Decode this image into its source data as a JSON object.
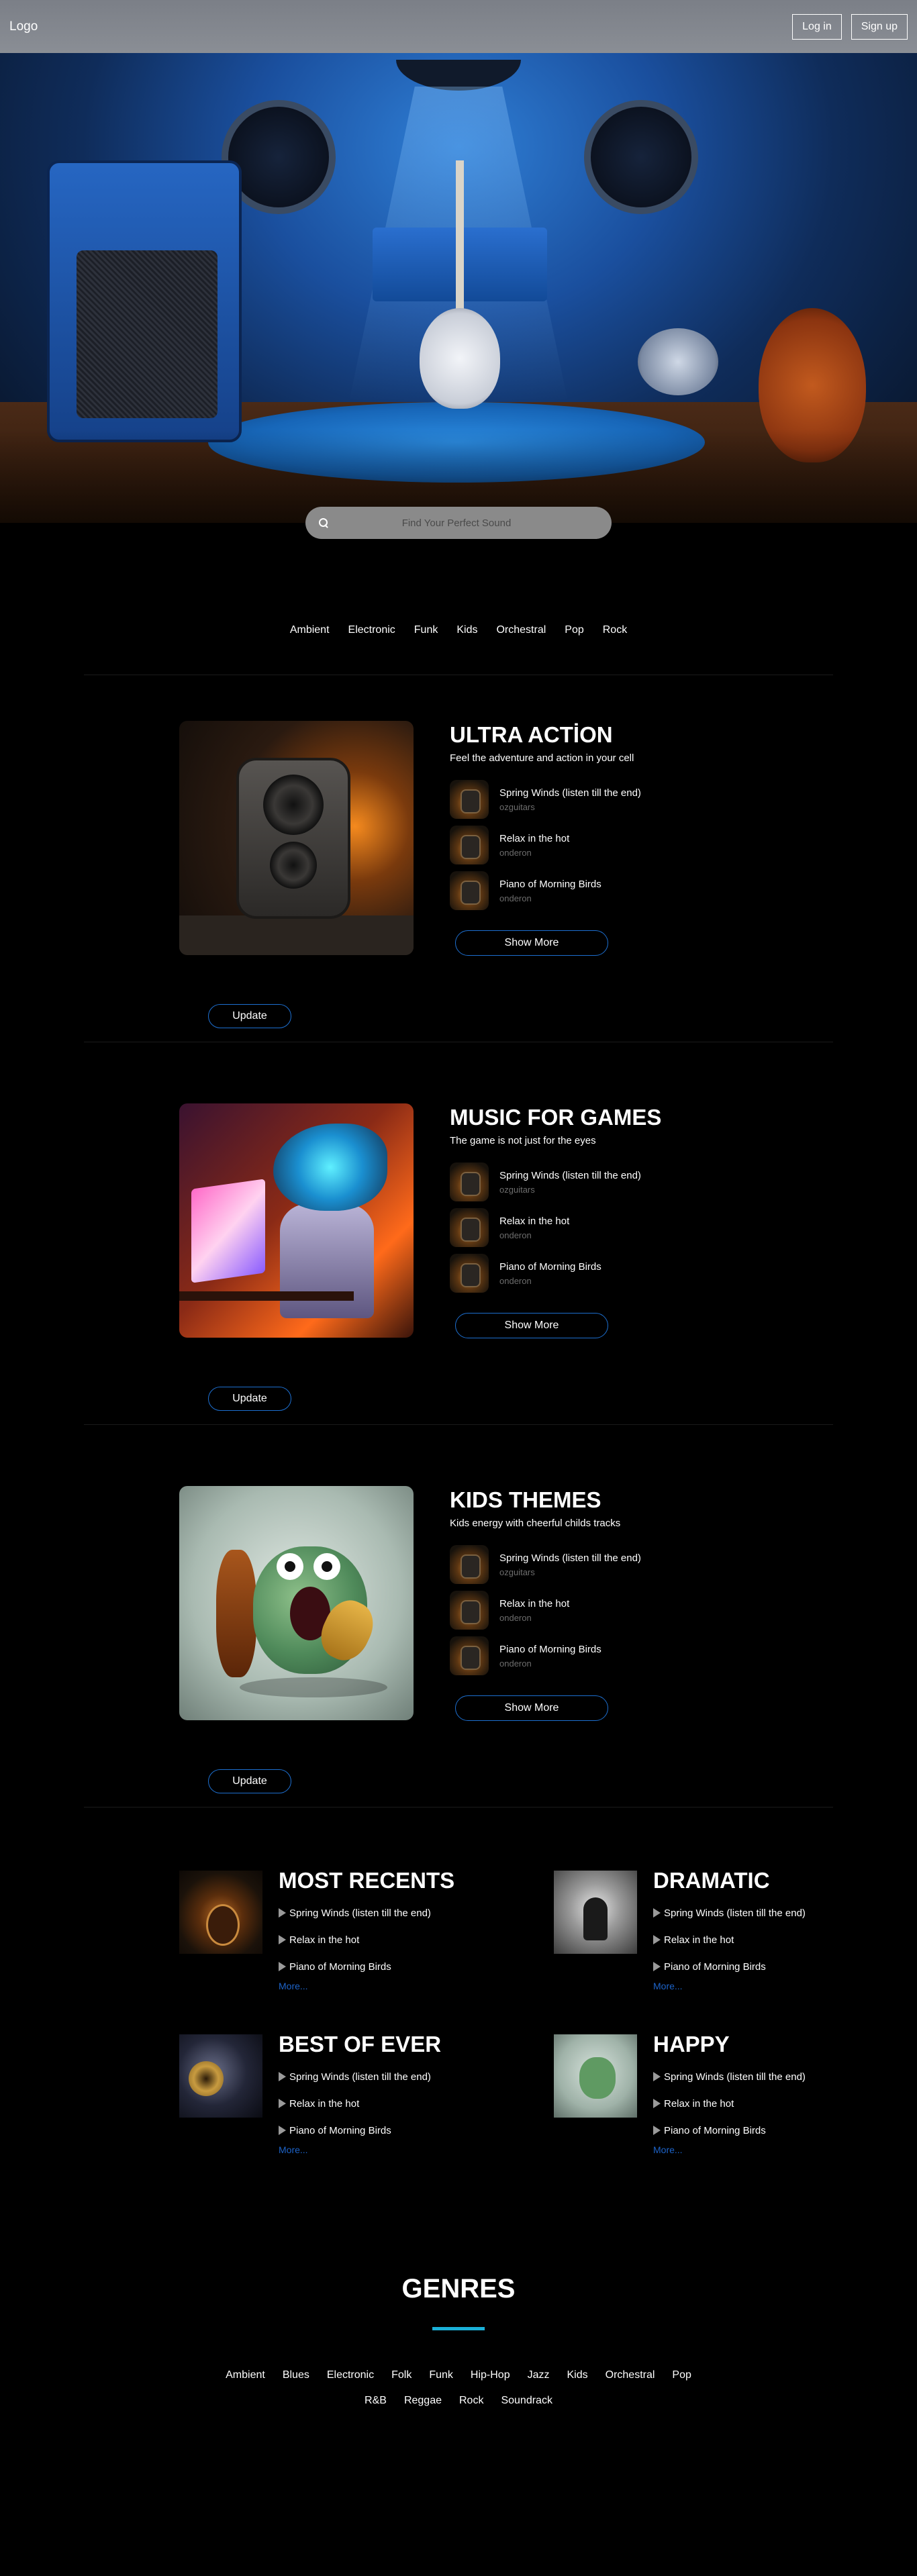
{
  "header": {
    "logo": "Logo",
    "login_label": "Log in",
    "signup_label": "Sign up"
  },
  "search": {
    "placeholder": "Find Your Perfect Sound"
  },
  "filters": [
    "Ambient",
    "Electronic",
    "Funk",
    "Kids",
    "Orchestral",
    "Pop",
    "Rock"
  ],
  "albums": [
    {
      "title": "ULTRA ACTİON",
      "subtitle": "Feel the adventure and action in your cell",
      "tracks": [
        {
          "name": "Spring Winds (listen till the end)",
          "artist": "ozguitars"
        },
        {
          "name": "Relax in the hot",
          "artist": "onderon"
        },
        {
          "name": "Piano of Morning Birds",
          "artist": "onderon"
        }
      ],
      "show_more_label": "Show More",
      "update_label": "Update"
    },
    {
      "title": "MUSIC FOR GAMES",
      "subtitle": "The game is not just for the eyes",
      "tracks": [
        {
          "name": "Spring Winds (listen till the end)",
          "artist": "ozguitars"
        },
        {
          "name": "Relax in the hot",
          "artist": "onderon"
        },
        {
          "name": "Piano of Morning Birds",
          "artist": "onderon"
        }
      ],
      "show_more_label": "Show More",
      "update_label": "Update"
    },
    {
      "title": "KIDS THEMES",
      "subtitle": "Kids energy with cheerful childs tracks",
      "tracks": [
        {
          "name": "Spring Winds (listen till the end)",
          "artist": "ozguitars"
        },
        {
          "name": "Relax in the hot",
          "artist": "onderon"
        },
        {
          "name": "Piano of Morning Birds",
          "artist": "onderon"
        }
      ],
      "show_more_label": "Show More",
      "update_label": "Update"
    }
  ],
  "collections": [
    {
      "title": "MOST RECENTS",
      "items": [
        "Spring Winds (listen till the end)",
        "Relax in the hot",
        "Piano of Morning Birds"
      ],
      "more_label": "More..."
    },
    {
      "title": "DRAMATIC",
      "items": [
        "Spring Winds (listen till the end)",
        "Relax in the hot",
        "Piano of Morning Birds"
      ],
      "more_label": "More..."
    },
    {
      "title": "BEST OF EVER",
      "items": [
        "Spring Winds (listen till the end)",
        "Relax in the hot",
        "Piano of Morning Birds"
      ],
      "more_label": "More..."
    },
    {
      "title": "HAPPY",
      "items": [
        "Spring Winds (listen till the end)",
        "Relax in the hot",
        "Piano of Morning Birds"
      ],
      "more_label": "More..."
    }
  ],
  "genres": {
    "title": "GENRES",
    "row1": [
      "Ambient",
      "Blues",
      "Electronic",
      "Folk",
      "Funk",
      "Hip-Hop",
      "Jazz",
      "Kids",
      "Orchestral",
      "Pop"
    ],
    "row2": [
      "R&B",
      "Reggae",
      "Rock",
      "Soundrack"
    ]
  },
  "colors": {
    "accent_blue": "#1d6fd0",
    "link_blue": "#1d63c8",
    "genres_underline": "#1ab0d8",
    "background": "#000000"
  }
}
